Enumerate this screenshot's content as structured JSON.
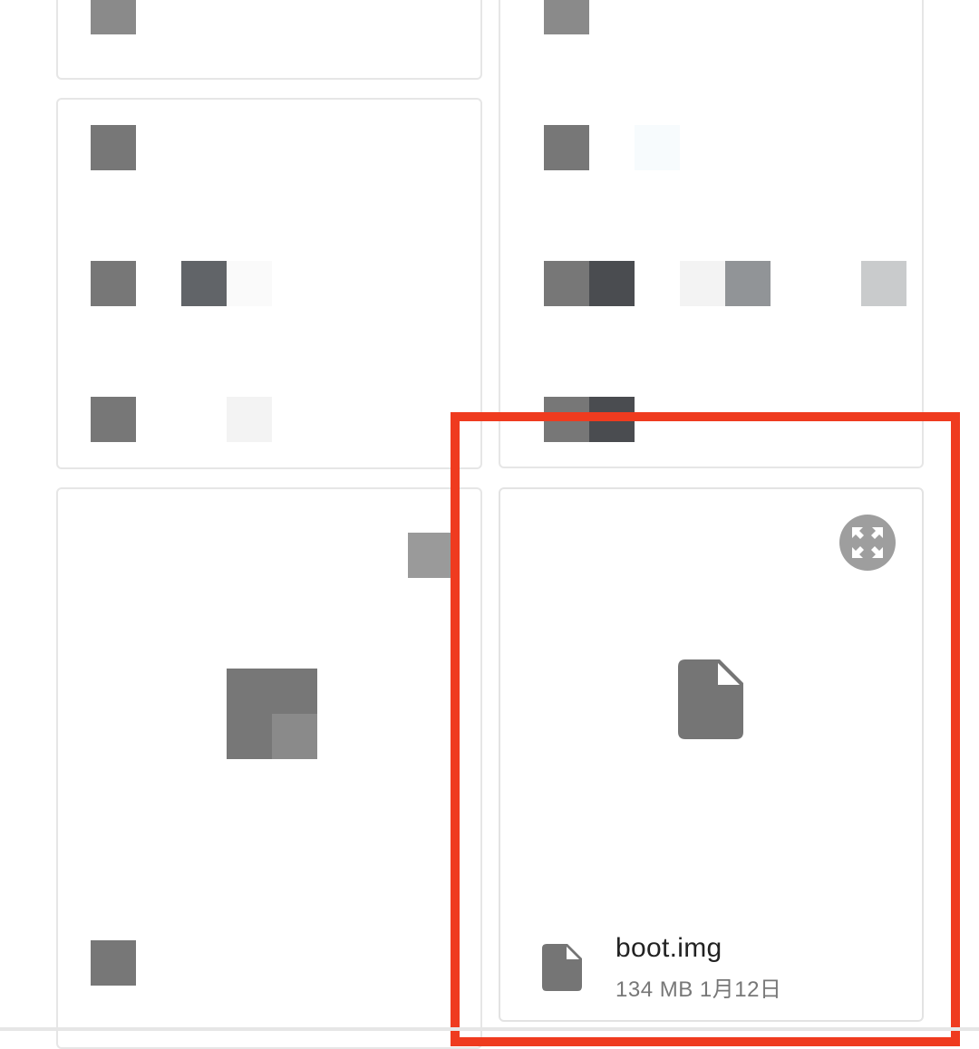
{
  "file": {
    "name": "boot.img",
    "size": "134 MB",
    "date": "1月12日",
    "icon": "file-icon"
  },
  "actions": {
    "expand_icon": "expand-arrows-icon"
  },
  "colors": {
    "highlight": "#ef3b1f",
    "icon_gray": "#757575",
    "card_border": "#e3e3e3"
  }
}
